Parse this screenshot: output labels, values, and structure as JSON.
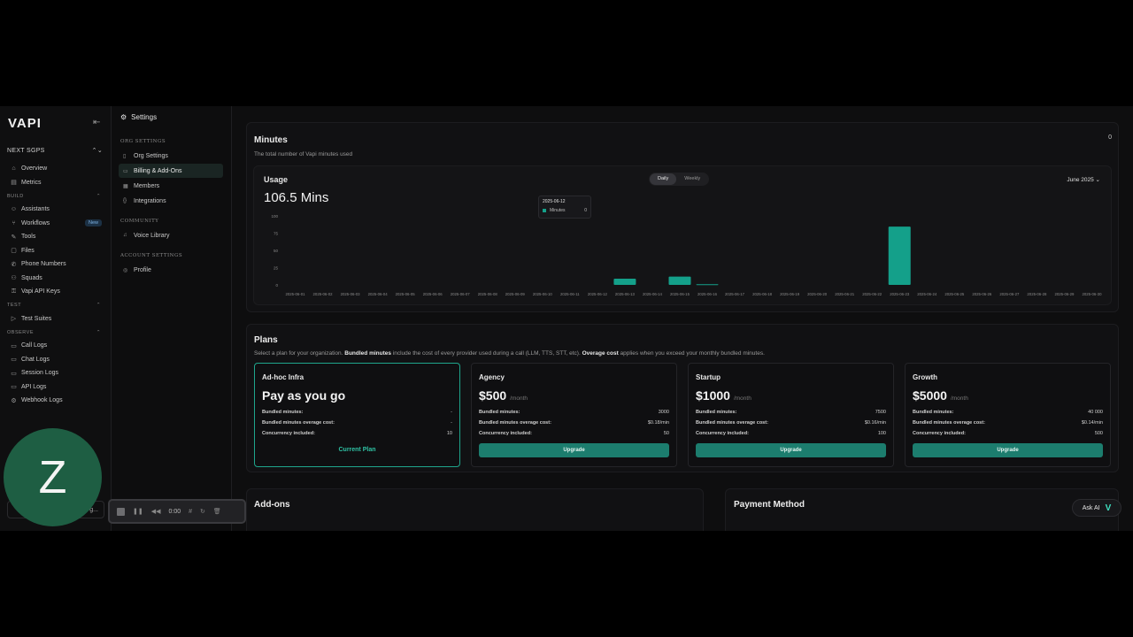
{
  "sidebar": {
    "logo": "VAPI",
    "org": "NEXT SGPS",
    "items": [
      {
        "type": "item",
        "label": "Overview",
        "icon": "⌂"
      },
      {
        "type": "item",
        "label": "Metrics",
        "icon": "▤"
      },
      {
        "type": "section",
        "label": "BUILD",
        "chevron": "⌃"
      },
      {
        "type": "item",
        "label": "Assistants",
        "icon": "☺"
      },
      {
        "type": "item",
        "label": "Workflows",
        "icon": "⑂",
        "badge": "New"
      },
      {
        "type": "item",
        "label": "Tools",
        "icon": "✎"
      },
      {
        "type": "item",
        "label": "Files",
        "icon": "▢"
      },
      {
        "type": "item",
        "label": "Phone Numbers",
        "icon": "✆"
      },
      {
        "type": "item",
        "label": "Squads",
        "icon": "⚇"
      },
      {
        "type": "item",
        "label": "Vapi API Keys",
        "icon": "⚿"
      },
      {
        "type": "section",
        "label": "TEST",
        "chevron": "⌃"
      },
      {
        "type": "item",
        "label": "Test Suites",
        "icon": "▷"
      },
      {
        "type": "section",
        "label": "OBSERVE",
        "chevron": "⌃"
      },
      {
        "type": "item",
        "label": "Call Logs",
        "icon": "▭"
      },
      {
        "type": "item",
        "label": "Chat Logs",
        "icon": "▭"
      },
      {
        "type": "item",
        "label": "Session Logs",
        "icon": "▭"
      },
      {
        "type": "item",
        "label": "API Logs",
        "icon": "▭"
      },
      {
        "type": "item",
        "label": "Webhook Logs",
        "icon": "⚙"
      }
    ],
    "footer_text": "g..."
  },
  "subnav": {
    "title": "Settings",
    "sections": [
      {
        "label": "ORG SETTINGS",
        "items": [
          {
            "label": "Org Settings",
            "icon": "▯",
            "active": false
          },
          {
            "label": "Billing & Add-Ons",
            "icon": "▭",
            "active": true
          },
          {
            "label": "Members",
            "icon": "▦",
            "active": false
          },
          {
            "label": "Integrations",
            "icon": "{}",
            "active": false
          }
        ]
      },
      {
        "label": "COMMUNITY",
        "items": [
          {
            "label": "Voice Library",
            "icon": "♫",
            "active": false
          }
        ]
      },
      {
        "label": "ACCOUNT SETTINGS",
        "items": [
          {
            "label": "Profile",
            "icon": "◎",
            "active": false
          }
        ]
      }
    ]
  },
  "minutes": {
    "title": "Minutes",
    "subtitle": "The total number of Vapi minutes used",
    "count": "0",
    "usage_title": "Usage",
    "total": "106.5 Mins",
    "toggle": {
      "daily": "Daily",
      "weekly": "Weekly"
    },
    "month": "June 2025",
    "tooltip": {
      "date": "2025-06-12",
      "series": "Minutes",
      "value": "0"
    }
  },
  "chart_data": {
    "type": "bar",
    "categories": [
      "2025-06-01",
      "2025-06-02",
      "2025-06-03",
      "2025-06-04",
      "2025-06-05",
      "2025-06-06",
      "2025-06-07",
      "2025-06-08",
      "2025-06-09",
      "2025-06-10",
      "2025-06-11",
      "2025-06-12",
      "2025-06-13",
      "2025-06-14",
      "2025-06-15",
      "2025-06-16",
      "2025-06-17",
      "2025-06-18",
      "2025-06-19",
      "2025-06-20",
      "2025-06-21",
      "2025-06-22",
      "2025-06-23",
      "2025-06-24",
      "2025-06-25",
      "2025-06-26",
      "2025-06-27",
      "2025-06-28",
      "2025-06-29",
      "2025-06-30"
    ],
    "values": [
      0,
      0,
      0,
      0,
      0,
      0,
      0,
      0,
      0,
      0,
      0,
      0,
      9,
      0,
      12,
      1,
      0,
      0,
      0,
      0,
      0,
      0,
      84.5,
      0,
      0,
      0,
      0,
      0,
      0,
      0
    ],
    "series_name": "Minutes",
    "yticks": [
      0,
      25,
      50,
      75,
      100
    ],
    "ylim": [
      0,
      100
    ],
    "color": "#14a08a",
    "grid": false
  },
  "plans": {
    "title": "Plans",
    "subtitle_parts": [
      {
        "text": "Select a plan for your organization. ",
        "bold": false
      },
      {
        "text": "Bundled minutes",
        "bold": true
      },
      {
        "text": " include the cost of every provider used during a call (LLM, TTS, STT, etc). ",
        "bold": false
      },
      {
        "text": "Overage cost",
        "bold": true
      },
      {
        "text": " applies when you exceed your monthly bundled minutes.",
        "bold": false
      }
    ],
    "row_labels": {
      "bundled": "Bundled minutes:",
      "overage": "Bundled minutes overage cost:",
      "concurrency": "Concurrency included:"
    },
    "items": [
      {
        "name": "Ad-hoc Infra",
        "price": "Pay as you go",
        "per": "",
        "bundled": "-",
        "overage": "-",
        "concurrency": "10",
        "action": "Current Plan",
        "current": true
      },
      {
        "name": "Agency",
        "price": "$500",
        "per": "/month",
        "bundled": "3000",
        "overage": "$0.18/min",
        "concurrency": "50",
        "action": "Upgrade",
        "current": false
      },
      {
        "name": "Startup",
        "price": "$1000",
        "per": "/month",
        "bundled": "7500",
        "overage": "$0.16/min",
        "concurrency": "100",
        "action": "Upgrade",
        "current": false
      },
      {
        "name": "Growth",
        "price": "$5000",
        "per": "/month",
        "bundled": "40 000",
        "overage": "$0.14/min",
        "concurrency": "500",
        "action": "Upgrade",
        "current": false
      }
    ]
  },
  "addons": {
    "title": "Add-ons"
  },
  "payment": {
    "title": "Payment Method"
  },
  "ask_ai": {
    "label": "Ask AI",
    "icon": "V"
  },
  "overlay": {
    "avatar_letter": "Z",
    "recorder_time": "0:00"
  }
}
